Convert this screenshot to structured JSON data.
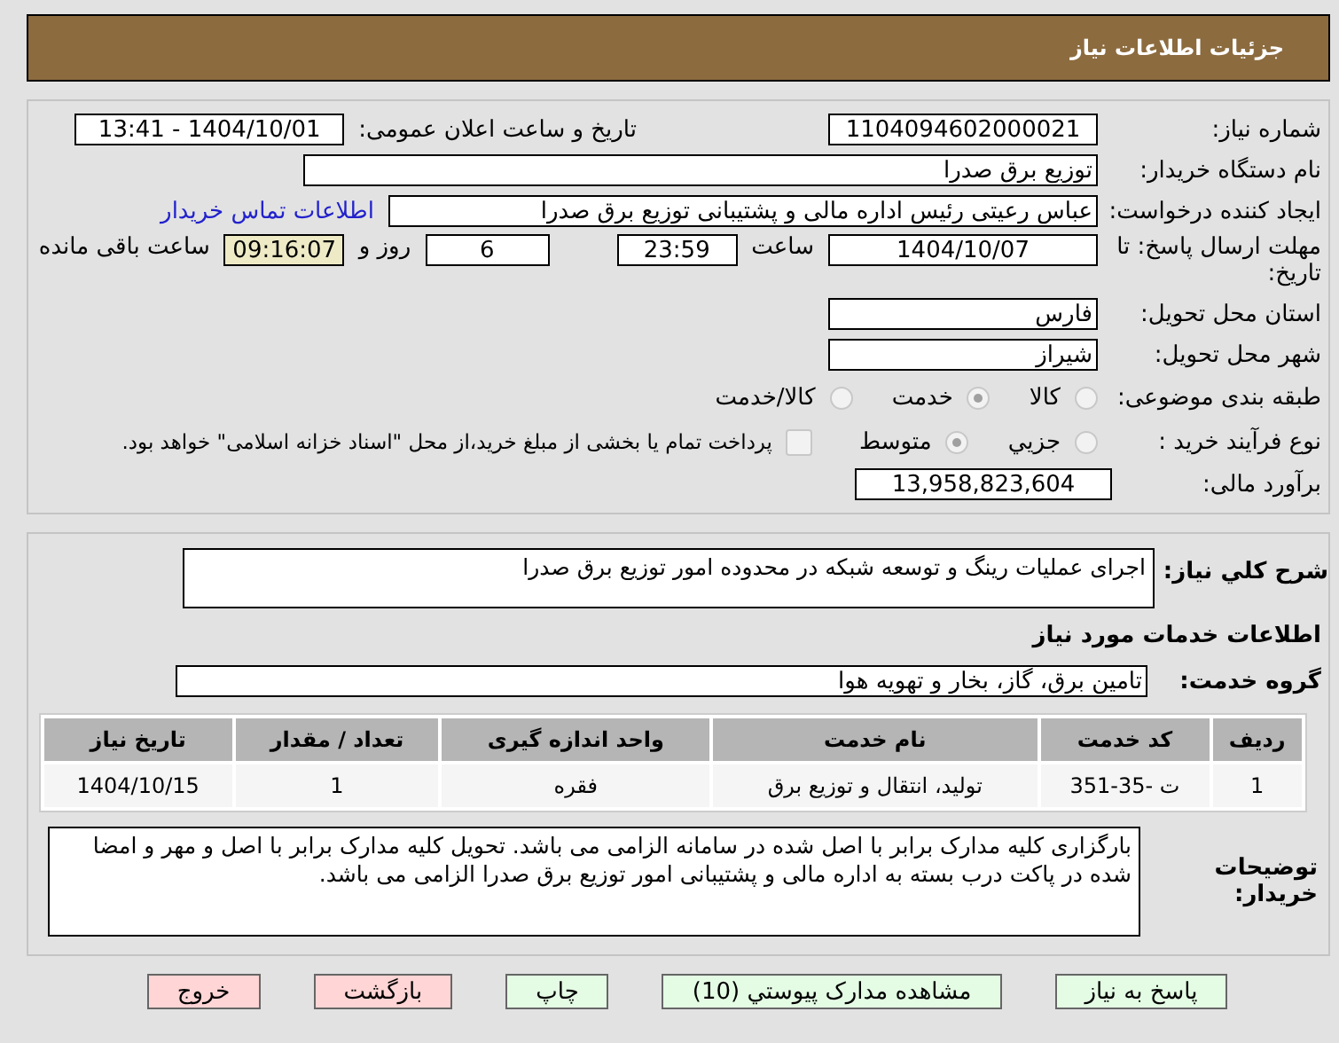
{
  "header": {
    "title": "جزئیات اطلاعات نیاز"
  },
  "need_number": {
    "label": "شماره نیاز:",
    "value": "1104094602000021"
  },
  "announce": {
    "label": "تاریخ و ساعت اعلان عمومی:",
    "value": "1404/10/01 - 13:41"
  },
  "buyer_org": {
    "label": "نام دستگاه خریدار:",
    "value": "توزیع برق صدرا"
  },
  "requester": {
    "label": "ایجاد کننده درخواست:",
    "value": "عباس رعیتی رئیس اداره مالی و پشتیبانی توزیع برق صدرا",
    "link": "اطلاعات تماس خریدار"
  },
  "deadline": {
    "label": "مهلت ارسال پاسخ: تا تاریخ:",
    "date": "1404/10/07",
    "time_label": "ساعت",
    "time": "23:59",
    "days": "6",
    "days_label": "روز و",
    "remaining": "09:16:07",
    "remaining_label": "ساعت باقی مانده"
  },
  "province": {
    "label": "استان محل تحویل:",
    "value": "فارس"
  },
  "city": {
    "label": "شهر محل تحویل:",
    "value": "شیراز"
  },
  "category": {
    "label": "طبقه بندی موضوعی:",
    "options": [
      {
        "label": "کالا",
        "selected": false
      },
      {
        "label": "خدمت",
        "selected": true
      },
      {
        "label": "کالا/خدمت",
        "selected": false
      }
    ]
  },
  "process": {
    "label": "نوع فرآیند خرید :",
    "options": [
      {
        "label": "جزیي",
        "selected": false
      },
      {
        "label": "متوسط",
        "selected": true
      }
    ],
    "payment": {
      "checked": false,
      "label": "پرداخت تمام یا بخشی از مبلغ خرید،از محل \"اسناد خزانه اسلامی\" خواهد بود."
    }
  },
  "budget": {
    "label": "برآورد مالی:",
    "value": "13,958,823,604"
  },
  "description": {
    "label": "شرح کلي نیاز:",
    "value": "اجرای عملیات رینگ و توسعه شبکه در محدوده امور توزیع برق صدرا"
  },
  "services_title": "اطلاعات خدمات مورد نیاز",
  "service_group": {
    "label": "گروه خدمت:",
    "value": "تامین برق، گاز، بخار و تهویه هوا"
  },
  "table": {
    "columns": [
      "ردیف",
      "کد خدمت",
      "نام خدمت",
      "واحد اندازه گیری",
      "تعداد / مقدار",
      "تاریخ نیاز"
    ],
    "rows": [
      [
        "1",
        "ت -35-351",
        "تولید، انتقال و توزیع برق",
        "فقره",
        "1",
        "1404/10/15"
      ]
    ]
  },
  "buyer_notes": {
    "label": "توضیحات خریدار:",
    "value": "بارگزاری کلیه مدارک برابر با اصل شده در سامانه الزامی می باشد. تحویل کلیه مدارک برابر با اصل و مهر و امضا شده در پاکت درب بسته به اداره مالی و پشتیبانی امور توزیع برق صدرا الزامی می باشد."
  },
  "buttons": [
    {
      "label": "پاسخ به نیاز",
      "color": "#e4fce4"
    },
    {
      "label": "مشاهده مدارک پیوستي (10)",
      "color": "#e4fce4"
    },
    {
      "label": "چاپ",
      "color": "#e4fce4"
    },
    {
      "label": "بازگشت",
      "color": "#ffd5d5"
    },
    {
      "label": "خروج",
      "color": "#ffd5d5"
    }
  ]
}
